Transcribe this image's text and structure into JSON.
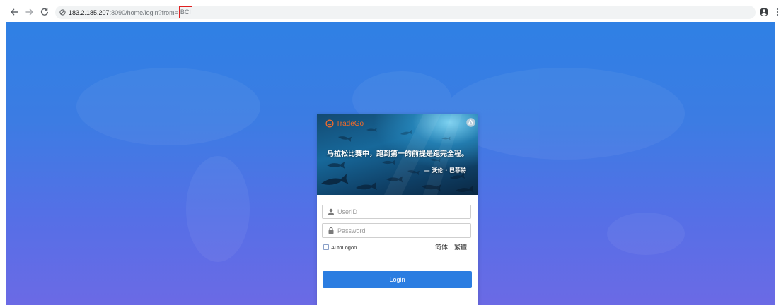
{
  "browser": {
    "toolbar": {
      "back_icon": "arrow-left-icon",
      "forward_icon": "arrow-right-icon",
      "reload_icon": "reload-icon",
      "account_icon": "account-circle-icon",
      "menu_icon": "kebab-menu-icon"
    },
    "address_bar": {
      "security_icon": "not-secure-icon",
      "host": "183.2.185.207",
      "path": ":8090/home/login?from=",
      "highlighted_query_value": "BCI",
      "highlight_color": "#e02020"
    }
  },
  "page": {
    "background_top_color": "#2f80e4",
    "background_bottom_color": "#6b6ae5"
  },
  "login": {
    "banner": {
      "logo_text": "TradeGo",
      "logo_color": "#f26b2a",
      "corner_icon": "recycle-icon",
      "quote": "马拉松比赛中，跑到第一的前提是跑完全程。",
      "attribution": "— 沃伦 · 巴菲特"
    },
    "userid": {
      "icon": "user-icon",
      "placeholder": "UserID",
      "value": ""
    },
    "password": {
      "icon": "lock-icon",
      "placeholder": "Password",
      "value": ""
    },
    "autologon": {
      "label": "AutoLogon",
      "checked": false
    },
    "languages": [
      {
        "label": "简体"
      },
      {
        "label": "繁體"
      }
    ],
    "submit": {
      "label": "Login",
      "color": "#2b7de1"
    }
  }
}
